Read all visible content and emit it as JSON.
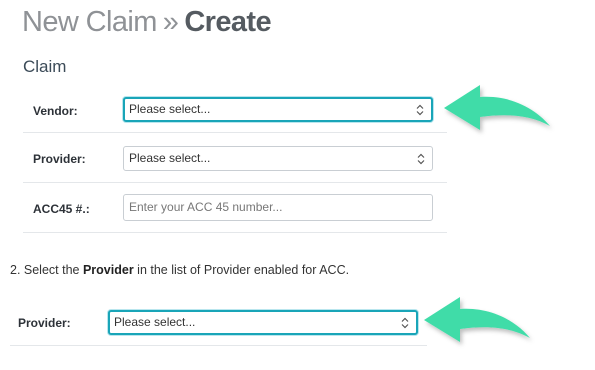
{
  "header": {
    "crumb": "New Claim",
    "separator": "»",
    "current": "Create"
  },
  "section": {
    "title": "Claim"
  },
  "form": {
    "vendor": {
      "label": "Vendor:",
      "value": "Please select..."
    },
    "provider": {
      "label": "Provider:",
      "value": "Please select..."
    },
    "acc45": {
      "label": "ACC45 #.:",
      "placeholder": "Enter your ACC 45 number..."
    }
  },
  "instruction": {
    "prefix": "2. Select the ",
    "emphasis": "Provider",
    "suffix": " in the list of Provider enabled for ACC."
  },
  "callout_form": {
    "provider": {
      "label": "Provider:",
      "value": "Please select..."
    }
  },
  "colors": {
    "arrow": "#3fdca8",
    "focus_border": "#19a5b8",
    "crumb_text": "#8f9296",
    "title_text": "#555b61"
  },
  "icons": {
    "select_chevron": "up-down-chevron-icon",
    "annotation": "curved-arrow-icon"
  }
}
